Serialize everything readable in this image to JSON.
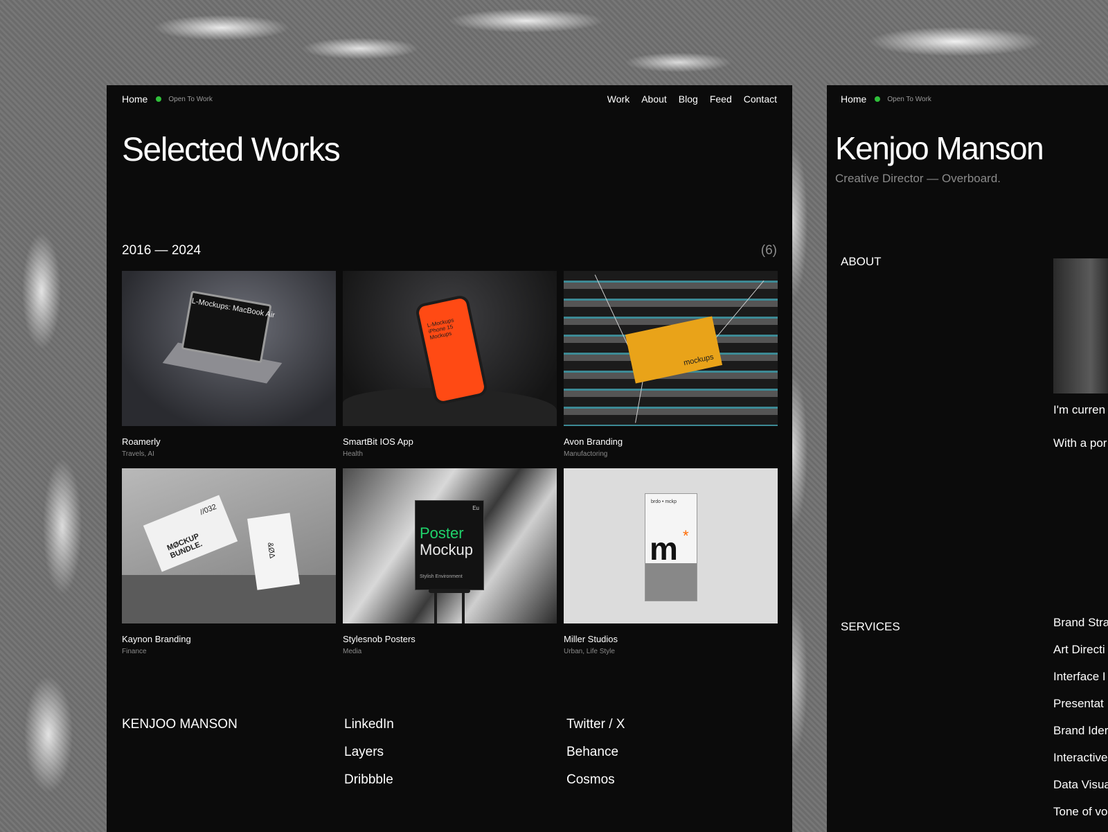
{
  "main": {
    "nav": {
      "home": "Home",
      "status": "Open To Work",
      "links": [
        "Work",
        "About",
        "Blog",
        "Feed",
        "Contact"
      ]
    },
    "title": "Selected Works",
    "range": "2016 — 2024",
    "count": "(6)",
    "works": [
      {
        "title": "Roamerly",
        "tags": "Travels, AI",
        "image_text": "L-Mockups: MacBook Air"
      },
      {
        "title": "SmartBit IOS App",
        "tags": "Health",
        "image_text": "L-Mockups iPhone 15 Mockups"
      },
      {
        "title": "Avon Branding",
        "tags": "Manufactoring",
        "image_text": "mockups"
      },
      {
        "title": "Kaynon Branding",
        "tags": "Finance",
        "image_text": "MØCKUP BUNDLE."
      },
      {
        "title": "Stylesnob Posters",
        "tags": "Media",
        "image_text": "Poster Mockup"
      },
      {
        "title": "Miller Studios",
        "tags": "Urban, Life Style",
        "image_text": "m"
      }
    ],
    "footer": {
      "name": "KENJOO MANSON",
      "col1": [
        "LinkedIn",
        "Layers",
        "Dribbble"
      ],
      "col2": [
        "Twitter / X",
        "Behance",
        "Cosmos"
      ]
    }
  },
  "side": {
    "nav": {
      "home": "Home",
      "status": "Open To Work"
    },
    "name": "Kenjoo Manson",
    "role": "Creative Director  — Overboard.",
    "about_label": "ABOUT",
    "bio": [
      "I'm curren expertise innovatior experienc",
      "With a por to exceller Currently and imagi"
    ],
    "services_label": "SERVICES",
    "services": [
      "Brand Stra",
      "Art Directi",
      "Interface I",
      "Presentat",
      "Brand Ider",
      "Interactive",
      "Data Visua",
      "Tone of vo"
    ]
  },
  "colors": {
    "background": "#0b0b0b",
    "status_dot": "#2fbf3a",
    "muted_text": "#8a8a8a"
  }
}
